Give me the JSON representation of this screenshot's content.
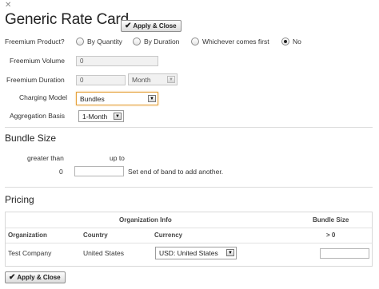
{
  "window": {
    "close_icon": "close-icon",
    "title": "Generic Rate Card"
  },
  "buttons": {
    "apply_close_label": "Apply & Close"
  },
  "freemium": {
    "product_label": "Freemium Product?",
    "options": [
      {
        "label": "By Quantity",
        "selected": false
      },
      {
        "label": "By Duration",
        "selected": false
      },
      {
        "label": "Whichever comes first",
        "selected": false
      },
      {
        "label": "No",
        "selected": true
      }
    ],
    "volume_label": "Freemium Volume",
    "volume_value": "0",
    "duration_label": "Freemium Duration",
    "duration_value": "0",
    "duration_unit": "Month"
  },
  "charging": {
    "label": "Charging Model",
    "value": "Bundles"
  },
  "aggregation": {
    "label": "Aggregation Basis",
    "value": "1-Month"
  },
  "bundle_size": {
    "title": "Bundle Size",
    "greater_than_label": "greater than",
    "up_to_label": "up to",
    "greater_than_value": "0",
    "up_to_value": "",
    "hint": "Set end of band to add another."
  },
  "pricing": {
    "title": "Pricing",
    "group_header_org_info": "Organization Info",
    "group_header_bundle_size": "Bundle Size",
    "columns": [
      "Organization",
      "Country",
      "Currency",
      "> 0"
    ],
    "rows": [
      {
        "organization": "Test Company",
        "country": "United States",
        "currency": "USD: United States",
        "bundle_value": ""
      }
    ]
  },
  "colors": {
    "focus_border": "#e5a23c",
    "section_divider": "#dcdcdc"
  }
}
